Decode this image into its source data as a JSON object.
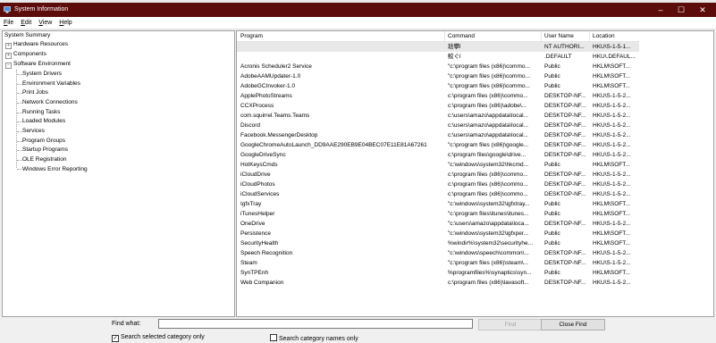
{
  "window": {
    "title": "System Information",
    "minimize": "–",
    "maximize": "☐",
    "close": "✕"
  },
  "menu": [
    "File",
    "Edit",
    "View",
    "Help"
  ],
  "tree": {
    "root": "System Summary",
    "hardware": "Hardware Resources",
    "components": "Components",
    "software": "Software Environment",
    "children": [
      "System Drivers",
      "Environment Variables",
      "Print Jobs",
      "Network Connections",
      "Running Tasks",
      "Loaded Modules",
      "Services",
      "Program Groups",
      "Startup Programs",
      "OLE Registration",
      "Windows Error Reporting"
    ]
  },
  "table": {
    "columns": [
      "Program",
      "Command",
      "User Name",
      "Location"
    ],
    "rows": [
      [
        "",
        "琀攀ǐ",
        "NT AUTHORI...",
        "HKU\\S-1-5-1..."
      ],
      [
        "",
        "鮫ぐǐ",
        ".DEFAULT",
        "HKU\\.DEFAUL..."
      ],
      [
        "Acronis Scheduler2 Service",
        "\"c:\\program files (x86)\\commo...",
        "Public",
        "HKLM\\SOFT..."
      ],
      [
        "AdobeAAMUpdater-1.0",
        "\"c:\\program files (x86)\\commo...",
        "Public",
        "HKLM\\SOFT..."
      ],
      [
        "AdobeGCInvoker-1.0",
        "\"c:\\program files (x86)\\commo...",
        "Public",
        "HKLM\\SOFT..."
      ],
      [
        "ApplePhotoStreams",
        "c:\\program files (x86)\\commo...",
        "DESKTOP-NF...",
        "HKU\\S-1-5-2..."
      ],
      [
        "CCXProcess",
        "c:\\program files (x86)\\adobe\\...",
        "DESKTOP-NF...",
        "HKU\\S-1-5-2..."
      ],
      [
        "com.squirrel.Teams.Teams",
        "c:\\users\\amazo\\appdata\\local...",
        "DESKTOP-NF...",
        "HKU\\S-1-5-2..."
      ],
      [
        "Discord",
        "c:\\users\\amazo\\appdata\\local...",
        "DESKTOP-NF...",
        "HKU\\S-1-5-2..."
      ],
      [
        "Facebook.MessengerDesktop",
        "c:\\users\\amazo\\appdata\\local...",
        "DESKTOP-NF...",
        "HKU\\S-1-5-2..."
      ],
      [
        "GoogleChromeAutoLaunch_DD9AAE290EB9E04BEC07E11E81A67261",
        "\"c:\\program files (x86)\\google...",
        "DESKTOP-NF...",
        "HKU\\S-1-5-2..."
      ],
      [
        "GoogleDriveSync",
        "c:\\program files\\google\\drive...",
        "DESKTOP-NF...",
        "HKU\\S-1-5-2..."
      ],
      [
        "HotKeysCmds",
        "\"c:\\windows\\system32\\hkcmd...",
        "Public",
        "HKLM\\SOFT..."
      ],
      [
        "iCloudDrive",
        "c:\\program files (x86)\\commo...",
        "DESKTOP-NF...",
        "HKU\\S-1-5-2..."
      ],
      [
        "iCloudPhotos",
        "c:\\program files (x86)\\commo...",
        "DESKTOP-NF...",
        "HKU\\S-1-5-2..."
      ],
      [
        "iCloudServices",
        "c:\\program files (x86)\\commo...",
        "DESKTOP-NF...",
        "HKU\\S-1-5-2..."
      ],
      [
        "IgfxTray",
        "\"c:\\windows\\system32\\igfxtray...",
        "Public",
        "HKLM\\SOFT..."
      ],
      [
        "iTunesHelper",
        "\"c:\\program files\\itunes\\itunes...",
        "Public",
        "HKLM\\SOFT..."
      ],
      [
        "OneDrive",
        "\"c:\\users\\amazo\\appdata\\loca...",
        "DESKTOP-NF...",
        "HKU\\S-1-5-2..."
      ],
      [
        "Persistence",
        "\"c:\\windows\\system32\\igfxper...",
        "Public",
        "HKLM\\SOFT..."
      ],
      [
        "SecurityHealth",
        "%windir%\\system32\\securityhe...",
        "Public",
        "HKLM\\SOFT..."
      ],
      [
        "Speech Recognition",
        "\"c:\\windows\\speech\\common\\...",
        "DESKTOP-NF...",
        "HKU\\S-1-5-2..."
      ],
      [
        "Steam",
        "\"c:\\program files (x86)\\steam\\...",
        "DESKTOP-NF...",
        "HKU\\S-1-5-2..."
      ],
      [
        "SynTPEnh",
        "%programfiles%\\synaptics\\syn...",
        "Public",
        "HKLM\\SOFT..."
      ],
      [
        "Web Companion",
        "c:\\program files (x86)\\lavasoft...",
        "DESKTOP-NF...",
        "HKU\\S-1-5-2..."
      ]
    ]
  },
  "find": {
    "label": "Find what:",
    "value": "",
    "find_button": "Find",
    "close_button": "Close Find",
    "option_selected": "Search selected category only",
    "option_selected_checked": true,
    "option_names": "Search category names only",
    "option_names_checked": false
  }
}
